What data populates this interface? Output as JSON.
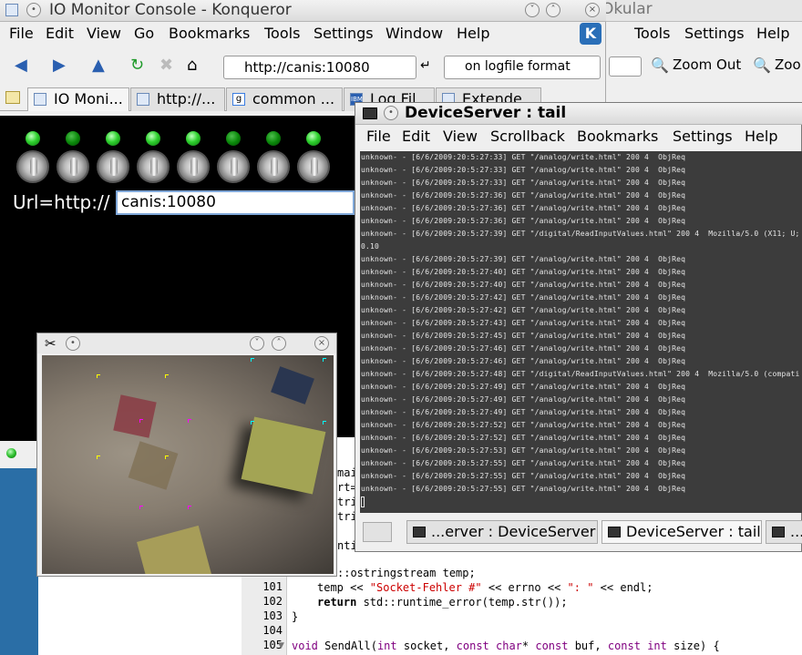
{
  "okular": {
    "title": "Okular",
    "menu": [
      "Tools",
      "Settings",
      "Help"
    ],
    "zoom_out": "Zoom Out",
    "zoom_in": "Zoo"
  },
  "konqueror": {
    "title": "IO Monitor Console - Konqueror",
    "menu": [
      "File",
      "Edit",
      "View",
      "Go",
      "Bookmarks",
      "Tools",
      "Settings",
      "Window",
      "Help"
    ],
    "location_url": "http://canis:10080",
    "search_text": "on logfile format",
    "tabs": [
      "IO Moni...",
      "http://...",
      "common ...",
      "Log Fil...",
      "Extende..."
    ],
    "content": {
      "url_label": "Url=http://",
      "url_value": "canis:10080"
    }
  },
  "camera": {
    "title": ""
  },
  "terminal": {
    "title": "DeviceServer : tail",
    "menu": [
      "File",
      "Edit",
      "View",
      "Scrollback",
      "Bookmarks",
      "Settings",
      "Help"
    ],
    "lines": [
      "unknown- - [6/6/2009:20:5:27:33] GET \"/analog/write.html\" 200 4  ObjReq",
      "unknown- - [6/6/2009:20:5:27:33] GET \"/analog/write.html\" 200 4  ObjReq",
      "unknown- - [6/6/2009:20:5:27:33] GET \"/analog/write.html\" 200 4  ObjReq",
      "unknown- - [6/6/2009:20:5:27:36] GET \"/analog/write.html\" 200 4  ObjReq",
      "unknown- - [6/6/2009:20:5:27:36] GET \"/analog/write.html\" 200 4  ObjReq",
      "unknown- - [6/6/2009:20:5:27:36] GET \"/analog/write.html\" 200 4  ObjReq",
      "unknown- - [6/6/2009:20:5:27:39] GET \"/digital/ReadInputValues.html\" 200 4  Mozilla/5.0 (X11; U;",
      "0.10",
      "unknown- - [6/6/2009:20:5:27:39] GET \"/analog/write.html\" 200 4  ObjReq",
      "unknown- - [6/6/2009:20:5:27:40] GET \"/analog/write.html\" 200 4  ObjReq",
      "unknown- - [6/6/2009:20:5:27:40] GET \"/analog/write.html\" 200 4  ObjReq",
      "unknown- - [6/6/2009:20:5:27:42] GET \"/analog/write.html\" 200 4  ObjReq",
      "unknown- - [6/6/2009:20:5:27:42] GET \"/analog/write.html\" 200 4  ObjReq",
      "unknown- - [6/6/2009:20:5:27:43] GET \"/analog/write.html\" 200 4  ObjReq",
      "unknown- - [6/6/2009:20:5:27:45] GET \"/analog/write.html\" 200 4  ObjReq",
      "unknown- - [6/6/2009:20:5:27:46] GET \"/analog/write.html\" 200 4  ObjReq",
      "unknown- - [6/6/2009:20:5:27:46] GET \"/analog/write.html\" 200 4  ObjReq",
      "unknown- - [6/6/2009:20:5:27:48] GET \"/digital/ReadInputValues.html\" 200 4  Mozilla/5.0 (compati",
      "unknown- - [6/6/2009:20:5:27:49] GET \"/analog/write.html\" 200 4  ObjReq",
      "unknown- - [6/6/2009:20:5:27:49] GET \"/analog/write.html\" 200 4  ObjReq",
      "unknown- - [6/6/2009:20:5:27:49] GET \"/analog/write.html\" 200 4  ObjReq",
      "unknown- - [6/6/2009:20:5:27:52] GET \"/analog/write.html\" 200 4  ObjReq",
      "unknown- - [6/6/2009:20:5:27:52] GET \"/analog/write.html\" 200 4  ObjReq",
      "unknown- - [6/6/2009:20:5:27:53] GET \"/analog/write.html\" 200 4  ObjReq",
      "unknown- - [6/6/2009:20:5:27:55] GET \"/analog/write.html\" 200 4  ObjReq",
      "unknown- - [6/6/2009:20:5:27:55] GET \"/analog/write.html\" 200 4  ObjReq",
      "unknown- - [6/6/2009:20:5:27:55] GET \"/analog/write.html\" 200 4  ObjReq"
    ],
    "tabs": [
      "...erver : DeviceServer",
      "DeviceServer : tail",
      "..."
    ]
  },
  "editor": {
    "partial_lines": [
      "mai",
      "rt=",
      "tri",
      "tri",
      "nti"
    ],
    "line_numbers": [
      "101",
      "102",
      "103",
      "104",
      "105"
    ],
    "code_line_100_prefix": "::ostringstream temp;",
    "code_line_101_a": "temp << ",
    "code_line_101_str": "\"Socket-Fehler #\"",
    "code_line_101_b": " << errno << ",
    "code_line_101_str2": "\": \"",
    "code_line_101_c": " << endl;",
    "code_line_102_kw": "return",
    "code_line_102_rest": " std::runtime_error(temp.str());",
    "code_line_103": "}",
    "code_line_105_a": "void",
    "code_line_105_b": " SendAll(",
    "code_line_105_c": "int",
    "code_line_105_d": " socket, ",
    "code_line_105_e": "const char",
    "code_line_105_f": "* ",
    "code_line_105_g": "const",
    "code_line_105_h": " buf, ",
    "code_line_105_i": "const int",
    "code_line_105_j": " size) {"
  }
}
